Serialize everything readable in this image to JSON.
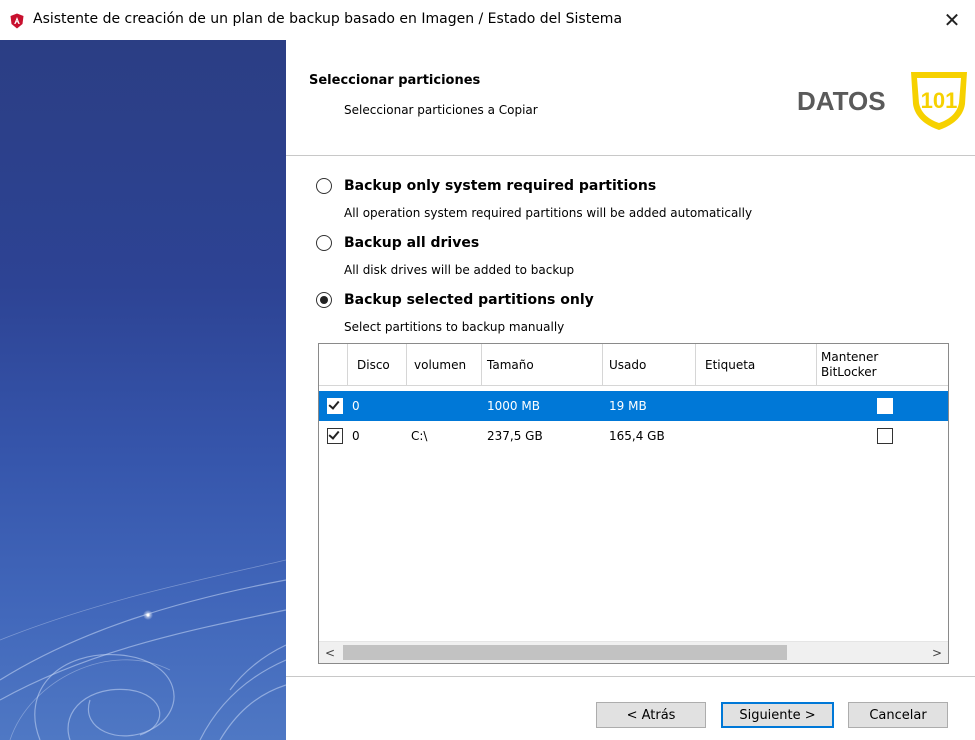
{
  "window": {
    "title": "Asistente de creación de un plan de backup basado en Imagen / Estado del Sistema",
    "close_glyph": "✕"
  },
  "header": {
    "title": "Seleccionar particiones",
    "subtitle": "Seleccionar particiones a Copiar",
    "logo_text": "DATOS",
    "logo_number": "101"
  },
  "options": [
    {
      "label": "Backup only system required partitions",
      "description": "All operation system required partitions will be added automatically",
      "checked": false
    },
    {
      "label": "Backup all drives",
      "description": "All disk drives will be added to backup",
      "checked": false
    },
    {
      "label": "Backup selected partitions only",
      "description": "Select partitions to backup manually",
      "checked": true
    }
  ],
  "table": {
    "columns": {
      "disco": "Disco",
      "volumen": "volumen",
      "tamano": "Tamaño",
      "usado": "Usado",
      "etiqueta": "Etiqueta",
      "mantener_line1": "Mantener",
      "mantener_line2": "BitLocker"
    },
    "rows": [
      {
        "checked": true,
        "disco": "0",
        "volumen": "",
        "tamano": "1000 MB",
        "usado": "19 MB",
        "etiqueta": "",
        "bitlocker": false,
        "selected": true
      },
      {
        "checked": true,
        "disco": "0",
        "volumen": "C:\\",
        "tamano": "237,5 GB",
        "usado": "165,4 GB",
        "etiqueta": "",
        "bitlocker": false,
        "selected": false
      }
    ],
    "scroll_left": "<",
    "scroll_right": ">"
  },
  "buttons": {
    "back": "< Atrás",
    "next": "Siguiente >",
    "cancel": "Cancelar"
  },
  "colors": {
    "selection": "#0078d7",
    "logo_yellow": "#f6d100",
    "logo_gray": "#5a5a5a",
    "panel_dark": "#2b3e84"
  }
}
